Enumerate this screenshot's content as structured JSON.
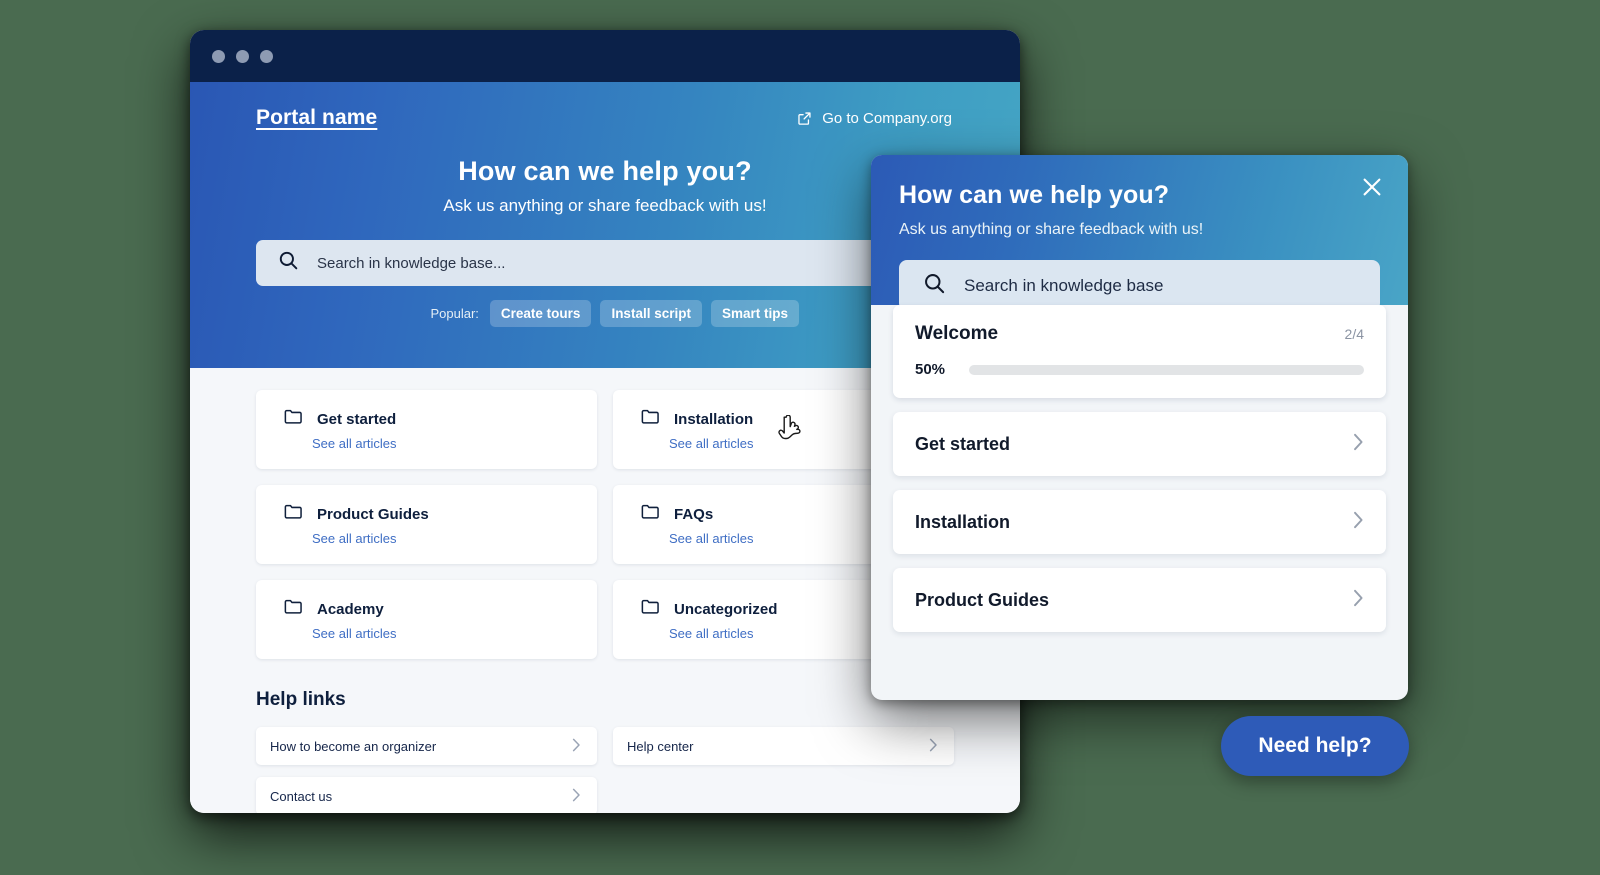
{
  "window": {
    "titlebar_dots": 3
  },
  "hero": {
    "portal_name": "Portal name",
    "company_link": "Go to Company.org",
    "title": "How can we help you?",
    "subtitle": "Ask us anything or share feedback with us!",
    "search_placeholder": "Search in knowledge base...",
    "popular_label": "Popular:",
    "popular_chips": [
      "Create tours",
      "Install script",
      "Smart tips"
    ],
    "gradient_start": "#2a57b4",
    "gradient_end": "#45a6c5"
  },
  "categories": [
    {
      "title": "Get started",
      "link": "See all articles"
    },
    {
      "title": "Installation",
      "link": "See all articles"
    },
    {
      "title": "Product Guides",
      "link": "See all articles"
    },
    {
      "title": "FAQs",
      "link": "See all articles"
    },
    {
      "title": "Academy",
      "link": "See all articles"
    },
    {
      "title": "Uncategorized",
      "link": "See all articles"
    }
  ],
  "help_links": {
    "heading": "Help links",
    "items": [
      {
        "label": "How to become an organizer"
      },
      {
        "label": "Help center"
      },
      {
        "label": "Contact us"
      }
    ]
  },
  "widget": {
    "title": "How can we help you?",
    "subtitle": "Ask us anything or share feedback with us!",
    "search_placeholder": "Search in knowledge base",
    "close_label": "×",
    "welcome": {
      "title": "Welcome",
      "count": "2/4",
      "percent_label": "50%",
      "percent_value": 50,
      "bar_color": "#10b457"
    },
    "items": [
      {
        "label": "Get started"
      },
      {
        "label": "Installation"
      },
      {
        "label": "Product Guides"
      }
    ]
  },
  "launcher": {
    "label": "Need help?",
    "color": "#2e5bb8"
  }
}
